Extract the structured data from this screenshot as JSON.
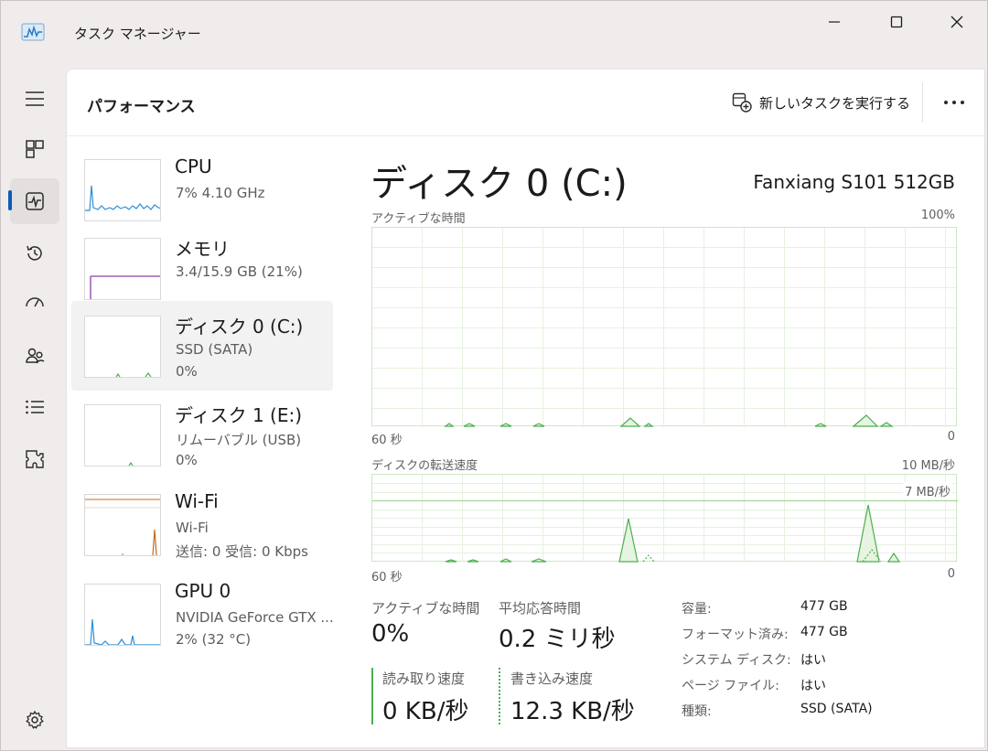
{
  "window": {
    "title": "タスク マネージャー"
  },
  "toolbar": {
    "page_title": "パフォーマンス",
    "run_task_label": "新しいタスクを実行する"
  },
  "devices": [
    {
      "name": "CPU",
      "line1": "7%  4.10 GHz",
      "line2": ""
    },
    {
      "name": "メモリ",
      "line1": "3.4/15.9 GB (21%)",
      "line2": ""
    },
    {
      "name": "ディスク 0 (C:)",
      "line1": "SSD (SATA)",
      "line2": "0%"
    },
    {
      "name": "ディスク 1 (E:)",
      "line1": "リムーバブル (USB)",
      "line2": "0%"
    },
    {
      "name": "Wi-Fi",
      "line1": "Wi-Fi",
      "line2": "送信: 0  受信: 0 Kbps"
    },
    {
      "name": "GPU 0",
      "line1": "NVIDIA GeForce GTX ...",
      "line2": "2%  (32 °C)"
    }
  ],
  "selected_device": "ディスク 0 (C:)",
  "detail": {
    "title": "ディスク 0 (C:)",
    "model": "Fanxiang S101 512GB",
    "active_graph": {
      "label": "アクティブな時間",
      "max": "100%",
      "x_left": "60 秒",
      "x_right": "0"
    },
    "transfer_graph": {
      "label": "ディスクの転送速度",
      "max": "10 MB/秒",
      "line_label": "7 MB/秒",
      "x_left": "60 秒",
      "x_right": "0"
    },
    "stats": {
      "active_time_label": "アクティブな時間",
      "active_time_value": "0%",
      "avg_response_label": "平均応答時間",
      "avg_response_value": "0.2 ミリ秒",
      "read_label": "読み取り速度",
      "read_value": "0 KB/秒",
      "write_label": "書き込み速度",
      "write_value": "12.3 KB/秒"
    },
    "properties": [
      {
        "label": "容量:",
        "value": "477 GB"
      },
      {
        "label": "フォーマット済み:",
        "value": "477 GB"
      },
      {
        "label": "システム ディスク:",
        "value": "はい"
      },
      {
        "label": "ページ ファイル:",
        "value": "はい"
      },
      {
        "label": "種類:",
        "value": "SSD (SATA)"
      }
    ]
  },
  "colors": {
    "accent": "#0a5cb8",
    "disk_line": "#4caf50",
    "disk_fill": "#e6f4e1",
    "cpu_line": "#2a8fd6",
    "memory_line": "#8e3fa8",
    "wifi_line": "#c46a1f"
  },
  "icons": {
    "app": "task-manager-icon",
    "nav": [
      "hamburger-menu-icon",
      "processes-icon",
      "performance-icon",
      "app-history-icon",
      "startup-apps-icon",
      "users-icon",
      "details-icon",
      "services-icon",
      "settings-icon"
    ],
    "run_task": "new-task-icon",
    "more": "more-options-icon"
  }
}
